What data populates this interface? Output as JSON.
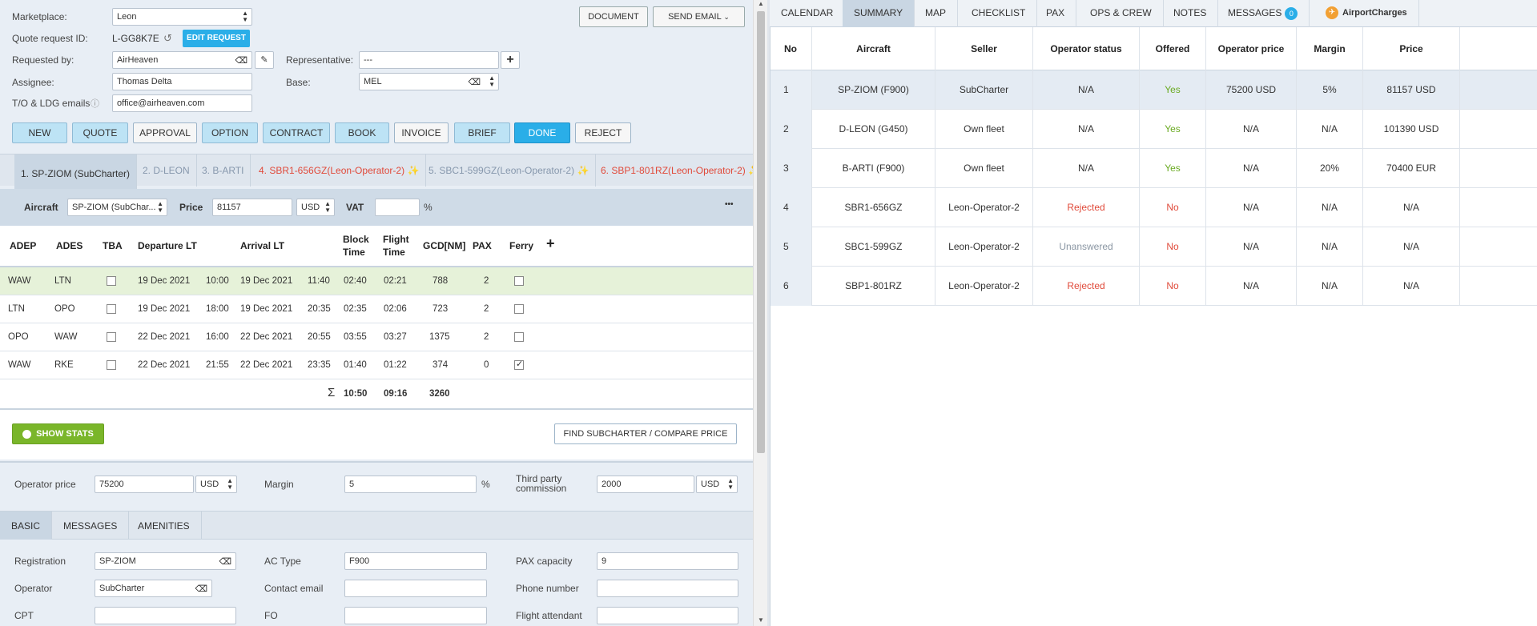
{
  "quote": {
    "marketplace_label": "Marketplace:",
    "marketplace_value": "Leon",
    "quote_id_label": "Quote request ID:",
    "quote_id_value": "L-GG8K7E",
    "edit_request_label": "EDIT REQUEST",
    "requested_by_label": "Requested by:",
    "requested_by_value": "AirHeaven",
    "representative_label": "Representative:",
    "representative_value": "---",
    "assignee_label": "Assignee:",
    "assignee_value": "Thomas Delta",
    "base_label": "Base:",
    "base_value": "MEL",
    "emails_label": "T/O & LDG emails",
    "emails_value": "office@airheaven.com",
    "document_label": "DOCUMENT",
    "send_email_label": "SEND EMAIL"
  },
  "status_buttons": [
    "NEW",
    "QUOTE",
    "APPROVAL",
    "OPTION",
    "CONTRACT",
    "BOOK",
    "INVOICE",
    "BRIEF",
    "DONE",
    "REJECT"
  ],
  "aircraft_tabs": [
    {
      "label": "1. SP-ZIOM (SubCharter)"
    },
    {
      "label": "2. D-LEON"
    },
    {
      "label": "3. B-ARTI"
    },
    {
      "label": "4. SBR1-656GZ(Leon-Operator-2)"
    },
    {
      "label": "5. SBC1-599GZ(Leon-Operator-2)"
    },
    {
      "label": "6. SBP1-801RZ(Leon-Operator-2)"
    }
  ],
  "aircraft_bar": {
    "aircraft_label": "Aircraft",
    "aircraft_value": "SP-ZIOM (SubChar...",
    "price_label": "Price",
    "price_value": "81157",
    "currency": "USD",
    "vat_label": "VAT",
    "vat_value": "",
    "percent": "%",
    "more": "•••"
  },
  "flight_headers": {
    "adep": "ADEP",
    "ades": "ADES",
    "tba": "TBA",
    "departure": "Departure LT",
    "arrival": "Arrival LT",
    "block1": "Block",
    "block2": "Time",
    "flight1": "Flight",
    "flight2": "Time",
    "gcd": "GCD[NM]",
    "pax": "PAX",
    "ferry": "Ferry",
    "add": "+"
  },
  "flights": [
    {
      "adep": "WAW",
      "ades": "LTN",
      "dep_date": "19 Dec 2021",
      "dep_time": "10:00",
      "arr_date": "19 Dec 2021",
      "arr_time": "11:40",
      "block": "02:40",
      "flight": "02:21",
      "gcd": "788",
      "pax": "2",
      "ferry": ""
    },
    {
      "adep": "LTN",
      "ades": "OPO",
      "dep_date": "19 Dec 2021",
      "dep_time": "18:00",
      "arr_date": "19 Dec 2021",
      "arr_time": "20:35",
      "block": "02:35",
      "flight": "02:06",
      "gcd": "723",
      "pax": "2",
      "ferry": ""
    },
    {
      "adep": "OPO",
      "ades": "WAW",
      "dep_date": "22 Dec 2021",
      "dep_time": "16:00",
      "arr_date": "22 Dec 2021",
      "arr_time": "20:55",
      "block": "03:55",
      "flight": "03:27",
      "gcd": "1375",
      "pax": "2",
      "ferry": ""
    },
    {
      "adep": "WAW",
      "ades": "RKE",
      "dep_date": "22 Dec 2021",
      "dep_time": "21:55",
      "arr_date": "22 Dec 2021",
      "arr_time": "23:35",
      "block": "01:40",
      "flight": "01:22",
      "gcd": "374",
      "pax": "0",
      "ferry": "✓"
    }
  ],
  "totals": {
    "sigma": "Σ",
    "block": "10:50",
    "flight": "09:16",
    "gcd": "3260"
  },
  "stats": {
    "show_stats_label": "SHOW STATS",
    "find_label": "FIND SUBCHARTER / COMPARE PRICE"
  },
  "pricing": {
    "operator_price_label": "Operator price",
    "operator_price_value": "75200",
    "operator_currency": "USD",
    "margin_label": "Margin",
    "margin_value": "5",
    "percent": "%",
    "third_party_label1": "Third party",
    "third_party_label2": "commission",
    "third_party_value": "2000",
    "third_party_currency": "USD"
  },
  "bottom_tabs": [
    "BASIC",
    "MESSAGES",
    "AMENITIES"
  ],
  "basic": {
    "registration_label": "Registration",
    "registration_value": "SP-ZIOM",
    "actype_label": "AC Type",
    "actype_value": "F900",
    "paxcap_label": "PAX capacity",
    "paxcap_value": "9",
    "operator_label": "Operator",
    "operator_value": "SubCharter",
    "contact_label": "Contact email",
    "contact_value": "",
    "phone_label": "Phone number",
    "phone_value": "",
    "cpt_label": "CPT",
    "cpt_value": "",
    "fo_label": "FO",
    "fo_value": "",
    "fa_label": "Flight attendant",
    "fa_value": ""
  },
  "right_tabs": [
    "CALENDAR",
    "SUMMARY",
    "MAP",
    "CHECKLIST",
    "PAX",
    "OPS & CREW",
    "NOTES",
    "MESSAGES",
    "AirportCharges"
  ],
  "messages_badge": "0",
  "summary_headers": [
    "No",
    "Aircraft",
    "Seller",
    "Operator status",
    "Offered",
    "Operator price",
    "Margin",
    "Price"
  ],
  "summary_rows": [
    {
      "no": "1",
      "aircraft": "SP-ZIOM (F900)",
      "seller": "SubCharter",
      "status": "N/A",
      "offered": "Yes",
      "op_price": "75200 USD",
      "margin": "5%",
      "price": "81157 USD"
    },
    {
      "no": "2",
      "aircraft": "D-LEON (G450)",
      "seller": "Own fleet",
      "status": "N/A",
      "offered": "Yes",
      "op_price": "N/A",
      "margin": "N/A",
      "price": "101390 USD"
    },
    {
      "no": "3",
      "aircraft": "B-ARTI (F900)",
      "seller": "Own fleet",
      "status": "N/A",
      "offered": "Yes",
      "op_price": "N/A",
      "margin": "20%",
      "price": "70400 EUR"
    },
    {
      "no": "4",
      "aircraft": "SBR1-656GZ",
      "seller": "Leon-Operator-2",
      "status": "Rejected",
      "offered": "No",
      "op_price": "N/A",
      "margin": "N/A",
      "price": "N/A"
    },
    {
      "no": "5",
      "aircraft": "SBC1-599GZ",
      "seller": "Leon-Operator-2",
      "status": "Unanswered",
      "offered": "No",
      "op_price": "N/A",
      "margin": "N/A",
      "price": "N/A"
    },
    {
      "no": "6",
      "aircraft": "SBP1-801RZ",
      "seller": "Leon-Operator-2",
      "status": "Rejected",
      "offered": "No",
      "op_price": "N/A",
      "margin": "N/A",
      "price": "N/A"
    }
  ],
  "colors": {
    "accent": "#2aaee8",
    "yes": "#6aaa22",
    "no": "#e04a3a",
    "selected_row": "#e6f2d9"
  }
}
